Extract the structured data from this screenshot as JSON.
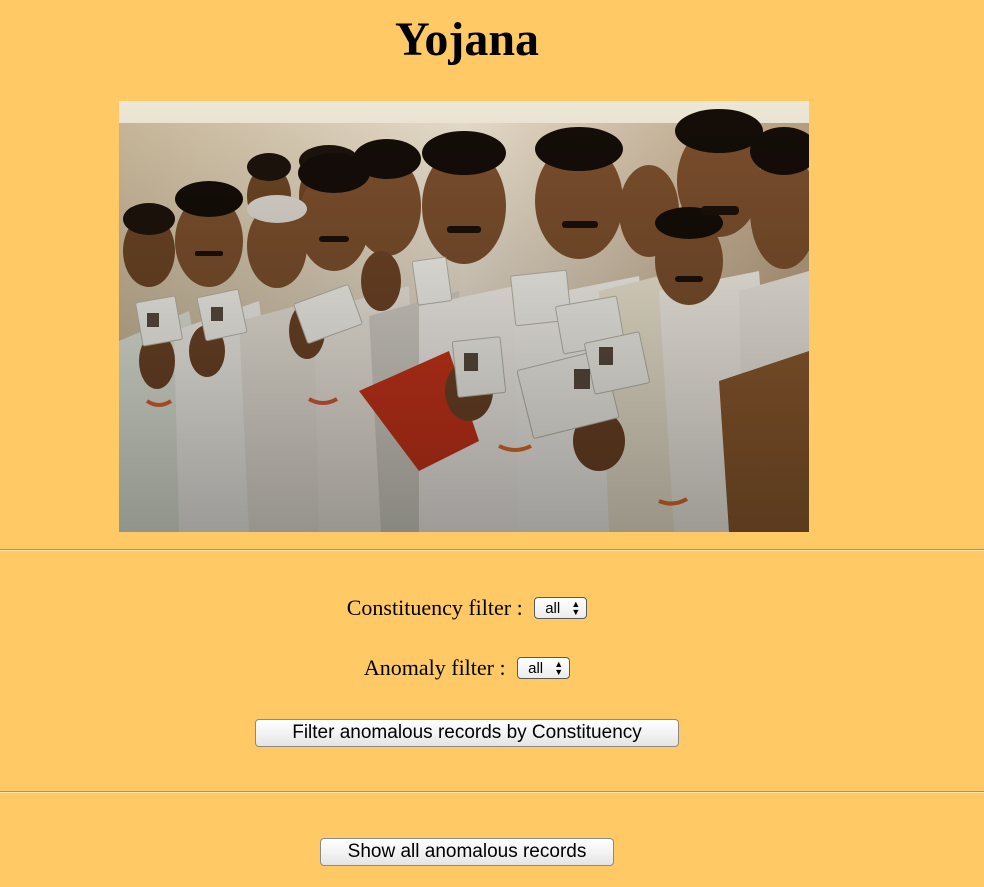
{
  "page": {
    "title": "Yojana"
  },
  "hero": {
    "alt": "Line of voters holding up their election identity cards"
  },
  "filters": {
    "constituency_label": "Constituency filter :",
    "constituency_value": "all",
    "anomaly_label": "Anomaly filter :",
    "anomaly_value": "all"
  },
  "actions": {
    "filter_button_label": "Filter anomalous records by Constituency",
    "show_all_button_label": "Show all anomalous records"
  },
  "colors": {
    "background": "#ffc965",
    "rule": "#a39474"
  }
}
